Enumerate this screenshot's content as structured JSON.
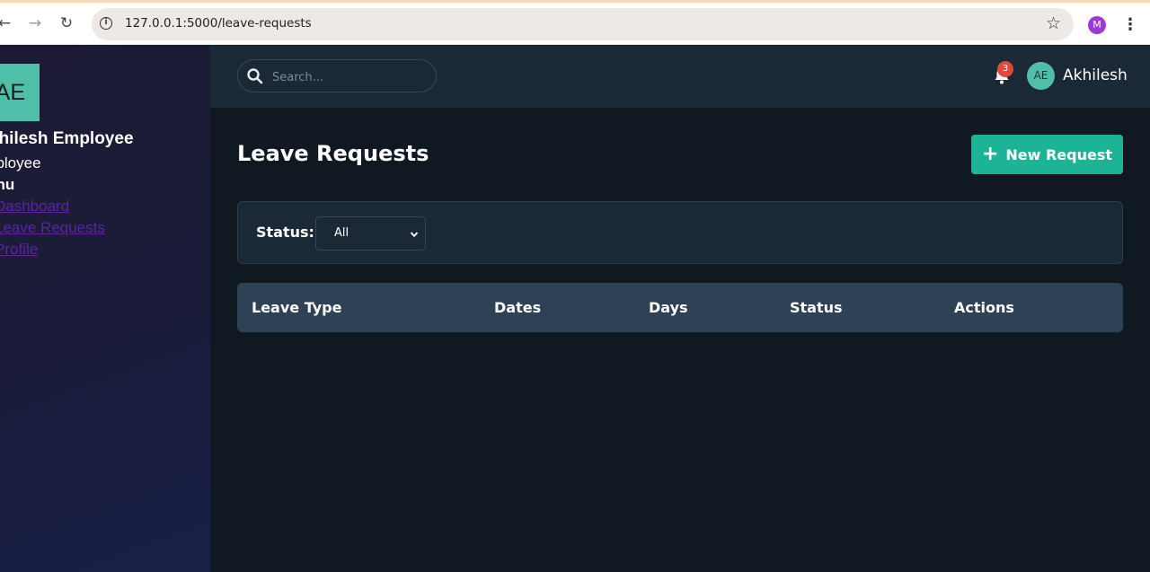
{
  "browser": {
    "url": "127.0.0.1:5000/leave-requests",
    "profile_initial": "M"
  },
  "sidebar": {
    "avatar_initials": "AE",
    "user_name": "khilesh Employee",
    "role": "nployee",
    "menu_heading": "enu",
    "links": [
      {
        "label": "Dashboard"
      },
      {
        "label": "Leave Requests"
      },
      {
        "label": "Profile"
      }
    ]
  },
  "topbar": {
    "search_placeholder": "Search...",
    "notification_count": "3",
    "user_initials": "AE",
    "user_name": "Akhilesh"
  },
  "main": {
    "title": "Leave Requests",
    "new_request_label": "New Request",
    "filter": {
      "status_label": "Status:",
      "selected": "All"
    },
    "table": {
      "columns": [
        "Leave Type",
        "Dates",
        "Days",
        "Status",
        "Actions"
      ]
    }
  },
  "colors": {
    "accent": "#1db397",
    "avatar": "#4fbfaa",
    "badge": "#e0483a",
    "page_bg": "#101922",
    "link": "#5c24a0"
  }
}
